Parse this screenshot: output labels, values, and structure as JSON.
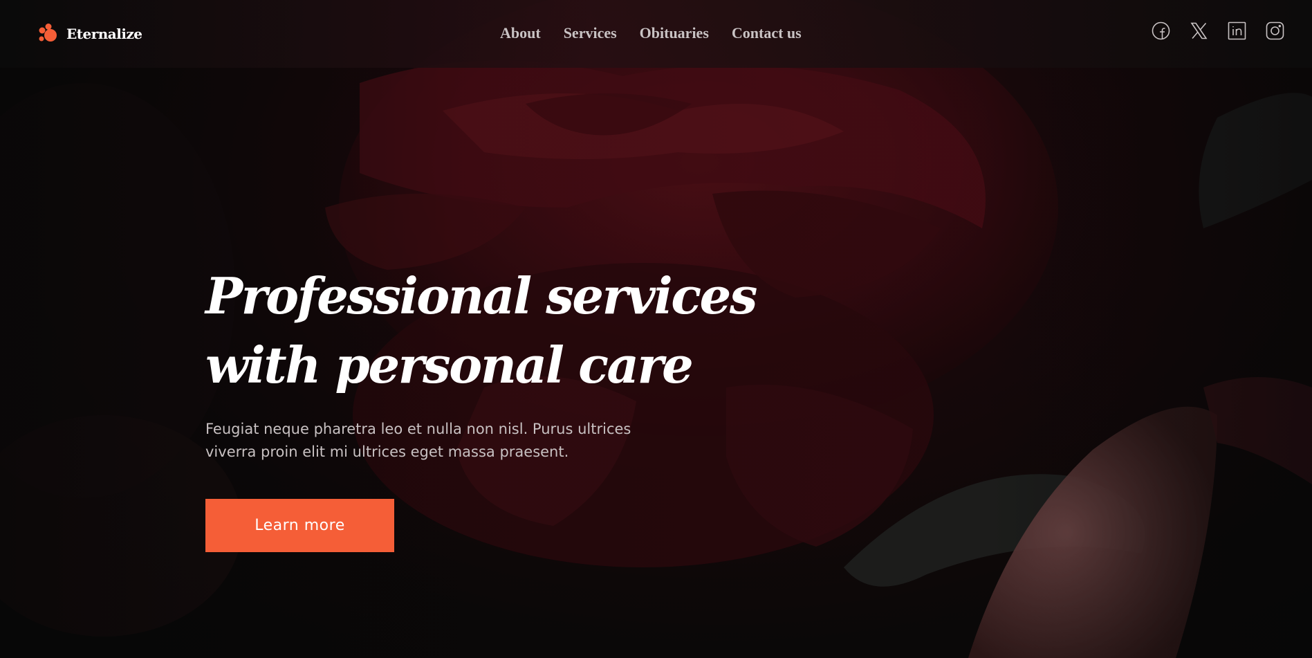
{
  "brand": {
    "name": "Eternalize",
    "accent_color": "#f55e37",
    "logo_icon": "paw-dots-logo-icon"
  },
  "nav": {
    "items": [
      {
        "label": "About"
      },
      {
        "label": "Services"
      },
      {
        "label": "Obituaries"
      },
      {
        "label": "Contact us"
      }
    ]
  },
  "socials": [
    {
      "icon": "facebook-icon"
    },
    {
      "icon": "x-twitter-icon"
    },
    {
      "icon": "linkedin-icon"
    },
    {
      "icon": "instagram-icon"
    }
  ],
  "hero": {
    "headline_line1": "Professional services",
    "headline_line2": "with personal care",
    "subtext": "Feugiat neque pharetra leo et nulla non nisl. Purus ultrices viverra proin elit mi ultrices eget massa praesent.",
    "cta_label": "Learn more",
    "background_image": "dark-red-rose-photo"
  }
}
